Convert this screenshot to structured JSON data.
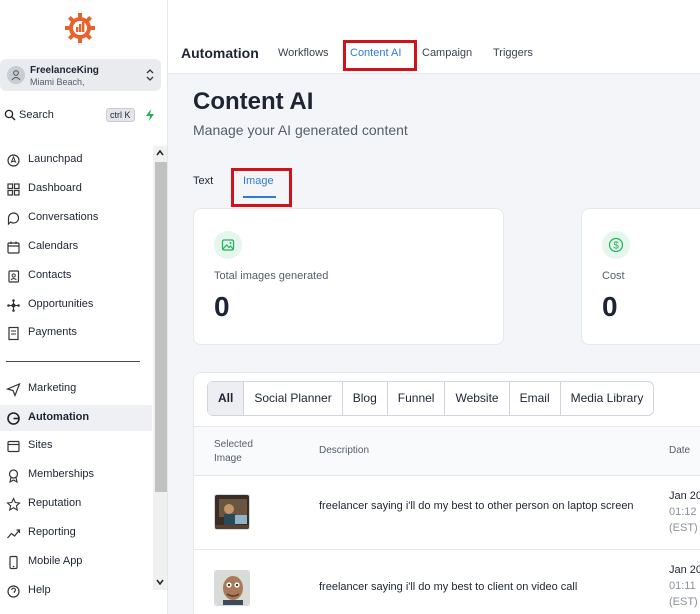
{
  "account": {
    "name": "FreelanceKing",
    "location": "Miami Beach,"
  },
  "search": {
    "label": "Search",
    "shortcut": "ctrl K"
  },
  "sidebar": {
    "items": [
      {
        "label": "Launchpad",
        "icon": "rocket-icon"
      },
      {
        "label": "Dashboard",
        "icon": "grid-icon"
      },
      {
        "label": "Conversations",
        "icon": "chat-icon"
      },
      {
        "label": "Calendars",
        "icon": "calendar-icon"
      },
      {
        "label": "Contacts",
        "icon": "contacts-icon"
      },
      {
        "label": "Opportunities",
        "icon": "network-icon"
      },
      {
        "label": "Payments",
        "icon": "receipt-icon"
      },
      {
        "label": "Marketing",
        "icon": "send-icon"
      },
      {
        "label": "Automation",
        "icon": "automation-icon",
        "active": true
      },
      {
        "label": "Sites",
        "icon": "sites-icon"
      },
      {
        "label": "Memberships",
        "icon": "award-icon"
      },
      {
        "label": "Reputation",
        "icon": "star-icon"
      },
      {
        "label": "Reporting",
        "icon": "trend-icon"
      },
      {
        "label": "Mobile App",
        "icon": "phone-icon"
      },
      {
        "label": "Help",
        "icon": "help-icon"
      }
    ]
  },
  "topbar": {
    "title": "Automation",
    "tabs": [
      {
        "label": "Workflows"
      },
      {
        "label": "Content AI",
        "active": true
      },
      {
        "label": "Campaign"
      },
      {
        "label": "Triggers"
      }
    ]
  },
  "page": {
    "title": "Content AI",
    "subtitle": "Manage your AI generated content",
    "tabs": [
      {
        "label": "Text"
      },
      {
        "label": "Image",
        "active": true
      }
    ]
  },
  "stats": [
    {
      "label": "Total images generated",
      "value": "0",
      "icon": "image-icon"
    },
    {
      "label": "Cost",
      "value": "0",
      "icon": "dollar-icon"
    }
  ],
  "filters": [
    "All",
    "Social Planner",
    "Blog",
    "Funnel",
    "Website",
    "Email",
    "Media Library"
  ],
  "table": {
    "headers": {
      "image": "Selected Image",
      "description": "Description",
      "date": "Date"
    },
    "rows": [
      {
        "description": "freelancer saying i'll do my best to other person on laptop screen",
        "date": "Jan 20",
        "time": "01:12",
        "tz": "(EST)"
      },
      {
        "description": "freelancer saying i'll do my best to client on video call",
        "date": "Jan 20",
        "time": "01:11",
        "tz": "(EST)"
      }
    ]
  },
  "colors": {
    "accent": "#2f7bd8",
    "highlight": "#d0121b",
    "logo": "#e8622c",
    "success": "#22b15a"
  }
}
